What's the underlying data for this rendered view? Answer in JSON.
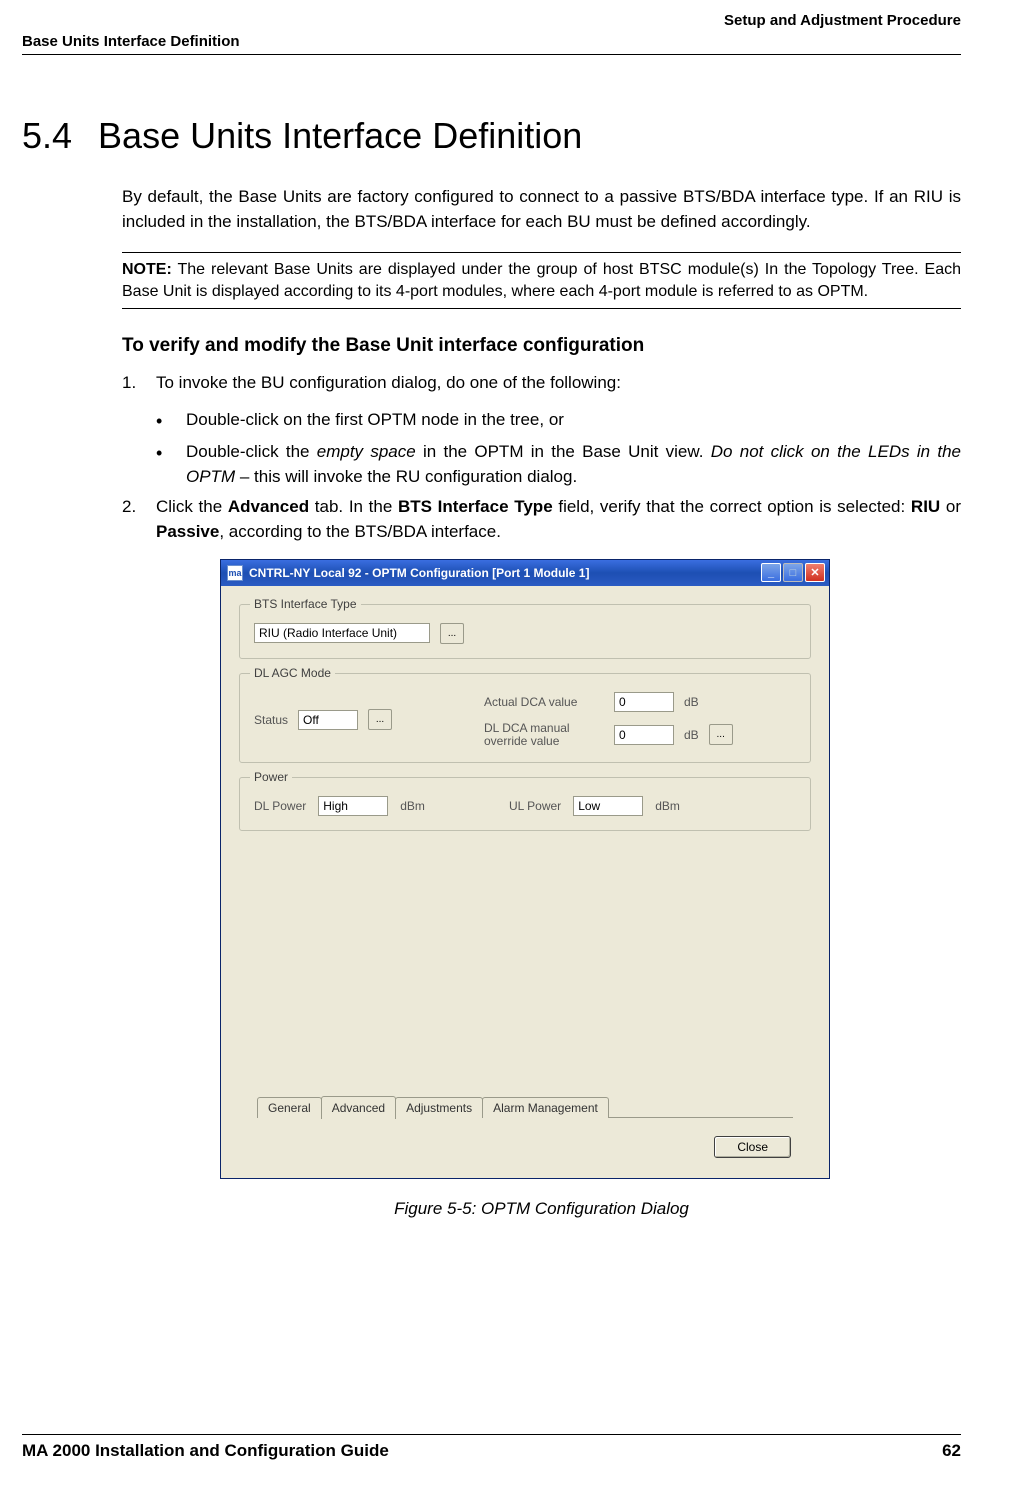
{
  "header": {
    "right": "Setup and Adjustment Procedure",
    "left": "Base Units Interface Definition"
  },
  "section": {
    "number": "5.4",
    "title": "Base Units Interface Definition"
  },
  "intro": "By default, the Base Units are factory configured to connect to a passive BTS/BDA interface type. If an RIU is included in the installation, the BTS/BDA interface for each BU must be defined accordingly.",
  "note": {
    "label": "NOTE:",
    "text": " The relevant Base Units are displayed under the group of host BTSC module(s) In the Topology Tree. Each Base Unit is displayed according to its 4-port modules, where each 4-port module is referred to as OPTM."
  },
  "subheading": "To verify and modify the Base Unit interface configuration",
  "steps": {
    "s1": {
      "num": "1.",
      "text": "To invoke the BU configuration dialog, do one of the following:",
      "b1": "Double-click on the first OPTM node in the tree, or",
      "b2a": "Double-click the ",
      "b2b": "empty space",
      "b2c": " in the OPTM in the Base Unit view. ",
      "b2d": "Do not click on the LEDs in the OPTM",
      "b2e": " – this will invoke the RU configuration dialog."
    },
    "s2": {
      "num": "2.",
      "a": "Click the ",
      "b": "Advanced",
      "c": " tab. In the ",
      "d": "BTS Interface Type",
      "e": " field, verify that the correct option is selected: ",
      "f": "RIU",
      "g": " or ",
      "h": "Passive",
      "i": ", according to the BTS/BDA interface."
    }
  },
  "dialog": {
    "titlebar_icon": "ma",
    "title": "CNTRL-NY Local 92 - OPTM Configuration [Port 1  Module 1]",
    "groups": {
      "bts": {
        "label": "BTS Interface Type",
        "value": "RIU (Radio Interface Unit)",
        "btn": "..."
      },
      "agc": {
        "label": "DL AGC Mode",
        "status_label": "Status",
        "status_value": "Off",
        "status_btn": "...",
        "actual_label": "Actual DCA value",
        "actual_value": "0",
        "actual_unit": "dB",
        "manual_label": "DL DCA manual override value",
        "manual_value": "0",
        "manual_unit": "dB",
        "manual_btn": "..."
      },
      "power": {
        "label": "Power",
        "dl_label": "DL Power",
        "dl_value": "High",
        "dl_unit": "dBm",
        "ul_label": "UL Power",
        "ul_value": "Low",
        "ul_unit": "dBm"
      }
    },
    "tabs": {
      "t1": "General",
      "t2": "Advanced",
      "t3": "Adjustments",
      "t4": "Alarm Management"
    },
    "close": "Close"
  },
  "figure_caption": "Figure 5-5: OPTM Configuration Dialog",
  "footer": {
    "left": "MA 2000 Installation and Configuration Guide",
    "right": "62"
  }
}
